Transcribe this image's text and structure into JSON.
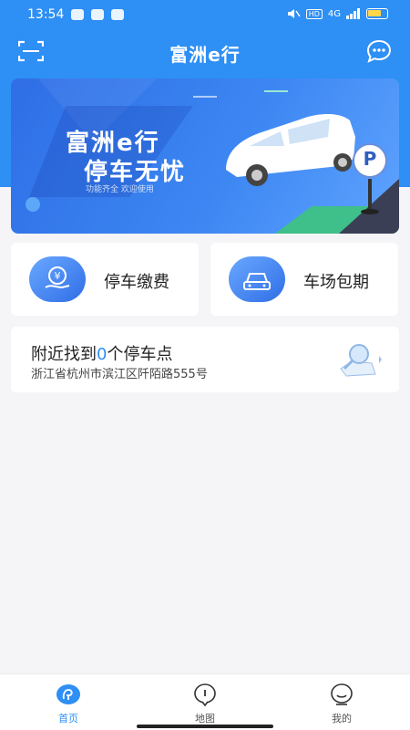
{
  "status_bar": {
    "time": "13:54",
    "signal_text": "4G",
    "hd_label": "HD"
  },
  "header": {
    "title": "富洲e行",
    "left_icon": "scan-icon",
    "right_icon": "more-icon"
  },
  "banner": {
    "title": "富洲e行",
    "slogan": "停车无忧",
    "small_text": "功能齐全 欢迎使用",
    "parking_sign": "P"
  },
  "tiles": [
    {
      "label": "停车缴费",
      "icon": "yuan-payment-icon"
    },
    {
      "label": "车场包期",
      "icon": "car-icon"
    }
  ],
  "nearby": {
    "prefix": "附近找到",
    "count": "0",
    "suffix": "个停车点",
    "address": "浙江省杭州市滨江区阡陌路555号",
    "icon": "map-search-icon"
  },
  "bottom_nav": {
    "items": [
      {
        "label": "首页",
        "icon": "home-icon",
        "active": true
      },
      {
        "label": "地图",
        "icon": "map-pin-icon",
        "active": false
      },
      {
        "label": "我的",
        "icon": "profile-icon",
        "active": false
      }
    ]
  },
  "colors": {
    "primary": "#2e8ff5",
    "banner_start": "#2f6ee6",
    "background": "#f5f5f7"
  }
}
